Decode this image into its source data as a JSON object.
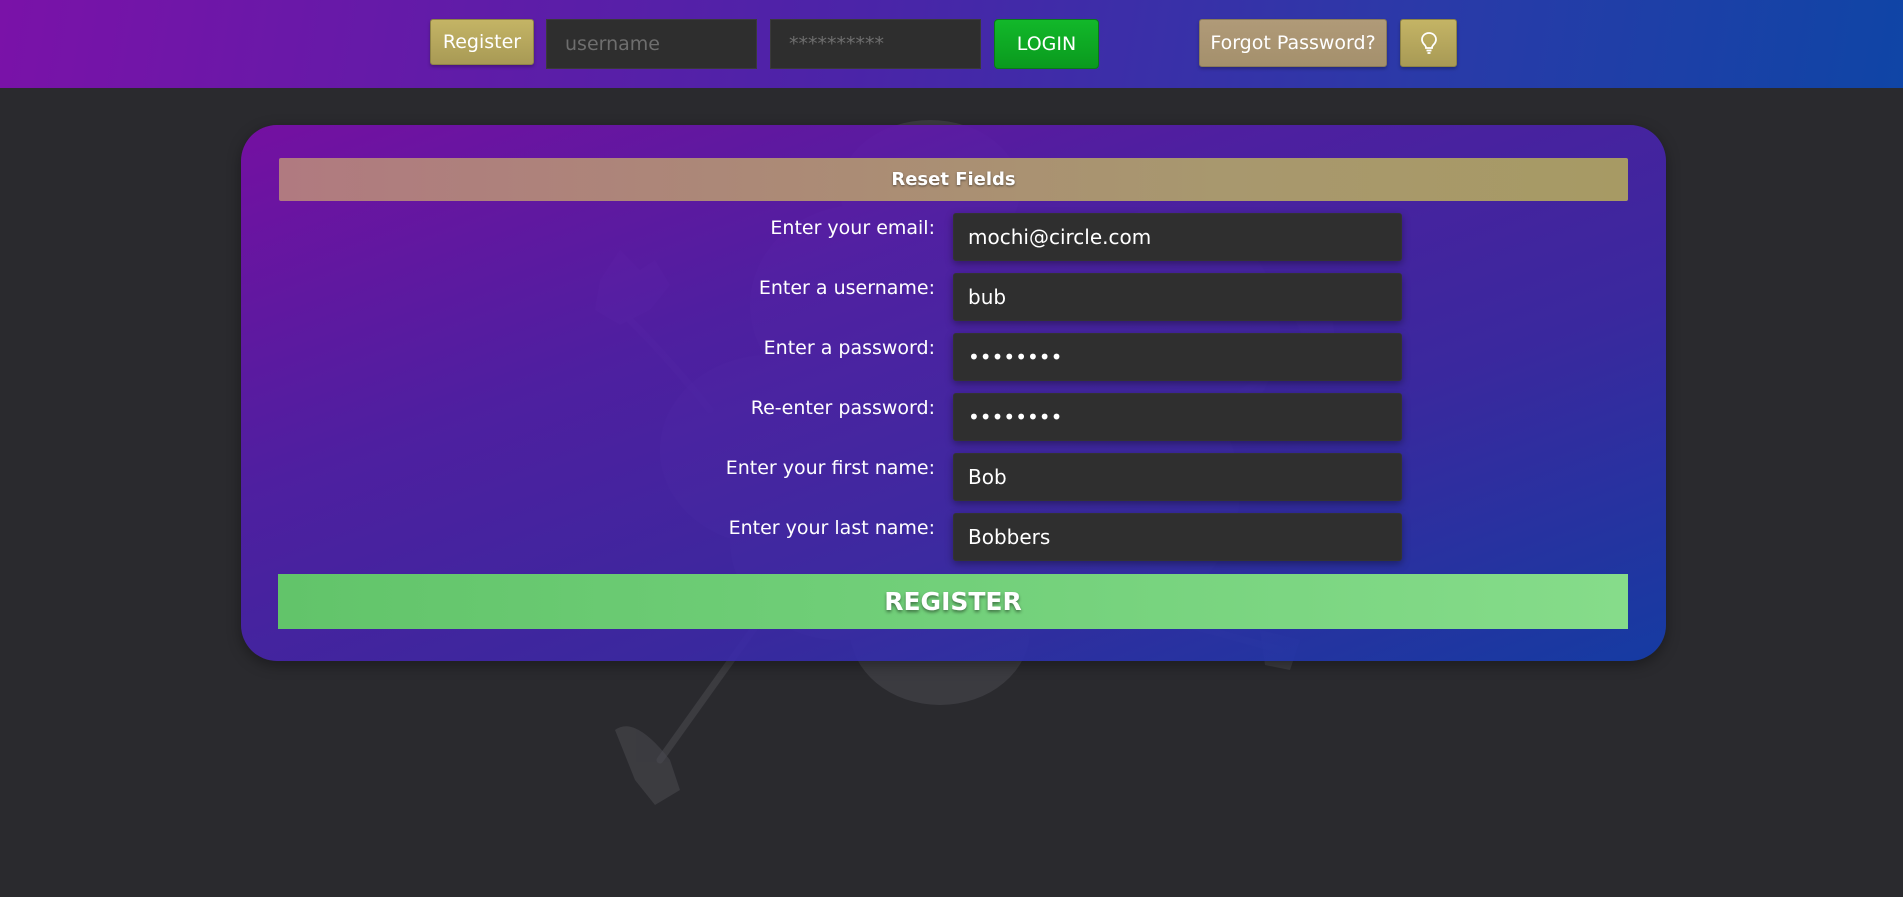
{
  "header": {
    "register_label": "Register",
    "username_placeholder": "username",
    "password_placeholder": "**********",
    "login_label": "LOGIN",
    "forgot_label": "Forgot Password?",
    "theme_icon": "lightbulb-icon"
  },
  "form": {
    "reset_label": "Reset Fields",
    "fields": [
      {
        "label": "Enter your email:",
        "type": "email",
        "value": "mochi@circle.com"
      },
      {
        "label": "Enter a username:",
        "type": "text",
        "value": "bub"
      },
      {
        "label": "Enter a password:",
        "type": "password",
        "value": "bbbbbbbb"
      },
      {
        "label": "Re-enter password:",
        "type": "password",
        "value": "bbbbbbbb"
      },
      {
        "label": "Enter your first name:",
        "type": "text",
        "value": "Bob"
      },
      {
        "label": "Enter your last name:",
        "type": "text",
        "value": "Bobbers"
      }
    ],
    "submit_label": "REGISTER"
  },
  "colors": {
    "header_gradient_start": "#7a12a8",
    "header_gradient_end": "#0f45a6",
    "login_green": "#12b82a",
    "gold_button": "#c4b465",
    "register_green": "#72d07a",
    "page_background": "#2a2a2e"
  }
}
